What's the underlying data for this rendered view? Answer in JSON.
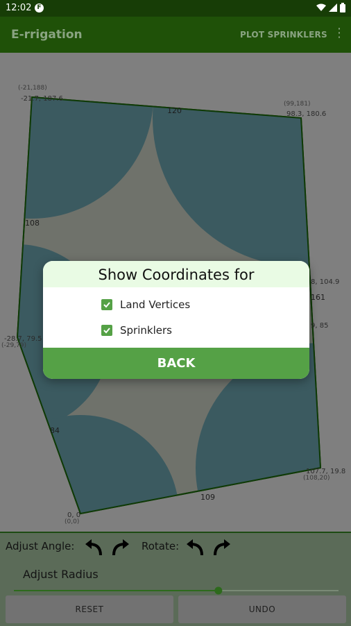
{
  "status": {
    "time": "12:02",
    "app_icon_letter": "F"
  },
  "appbar": {
    "title": "E-rrigation",
    "action": "PLOT SPRINKLERS",
    "overflow": "⋮"
  },
  "plot_labels": {
    "vertex_top_left_coords": "(-21,188)",
    "vertex_top_left_value": "-21.7, 187.6",
    "edge_top": "120",
    "vertex_top_right_coords": "(99,181)",
    "vertex_top_right_value": "98.3, 180.6",
    "edge_left_upper": "108",
    "right_value_a": "8, 104.9",
    "edge_right": "161",
    "right_value_b": "9, 85",
    "vertex_left_value": "-28.7, 79.5",
    "vertex_left_coords": "(-29,79)",
    "edge_left_lower": "84",
    "vertex_bottom_right_value": "107.7, 19.8",
    "vertex_bottom_right_coords": "(108,20)",
    "edge_bottom": "109",
    "vertex_origin_value": "0, 0",
    "vertex_origin_coords": "(0,0)"
  },
  "dialog": {
    "title": "Show Coordinates for",
    "options": [
      {
        "label": "Land Vertices",
        "checked": true
      },
      {
        "label": "Sprinklers",
        "checked": true
      }
    ],
    "back_label": "BACK"
  },
  "controls": {
    "adjust_angle_label": "Adjust Angle:",
    "rotate_label": "Rotate:",
    "adjust_radius_label": "Adjust Radius",
    "radius_value": 0.63,
    "reset_label": "RESET",
    "undo_label": "UNDO"
  },
  "colors": {
    "accent": "#55a146",
    "appbar": "#1f5108",
    "land": "#3b5a60",
    "sprinkler": "#294950"
  }
}
